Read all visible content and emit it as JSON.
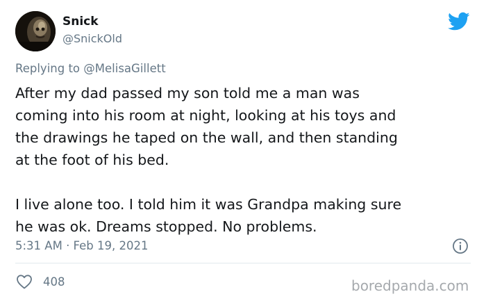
{
  "user": {
    "display_name": "Snick",
    "handle": "@SnickOld"
  },
  "reply": {
    "prefix": "Replying to",
    "mention": "@MelisaGillett"
  },
  "tweet": {
    "paragraph1_lines": [
      "After my dad passed my son told me a man was",
      "coming into his room at night, looking at his toys and",
      "the drawings he taped on the wall, and then standing",
      "at the foot of his bed."
    ],
    "paragraph2_lines": [
      "I live alone too. I told him it was Grandpa making sure",
      "he was ok. Dreams stopped. No problems."
    ]
  },
  "meta": {
    "timestamp": "5:31 AM · Feb 19, 2021"
  },
  "engagement": {
    "likes": "408"
  },
  "watermark": "boredpanda.com",
  "colors": {
    "twitter_blue": "#1da1f2",
    "secondary_text": "#657786",
    "primary_text": "#14171a",
    "divider": "#e1e8ed",
    "watermark": "#a5a9ad"
  },
  "icons": {
    "brand": "twitter-bird-icon",
    "info": "info-icon",
    "like": "heart-icon"
  }
}
